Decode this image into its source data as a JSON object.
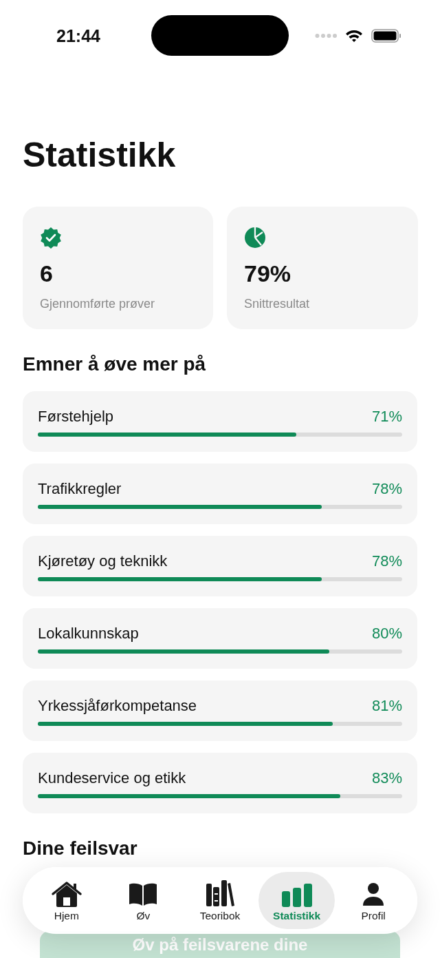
{
  "status_bar": {
    "time": "21:44"
  },
  "title": "Statistikk",
  "summary_cards": [
    {
      "kind": "badge",
      "value": "6",
      "label": "Gjennomførte prøver"
    },
    {
      "kind": "pie",
      "value": "79%",
      "label": "Snittresultat"
    }
  ],
  "topics_heading": "Emner å øve mer på",
  "topics": [
    {
      "name": "Førstehjelp",
      "percent": "71%",
      "level": 0.71
    },
    {
      "name": "Trafikkregler",
      "percent": "78%",
      "level": 0.78
    },
    {
      "name": "Kjøretøy og teknikk",
      "percent": "78%",
      "level": 0.78
    },
    {
      "name": "Lokalkunnskap",
      "percent": "80%",
      "level": 0.8
    },
    {
      "name": "Yrkessjåførkompetanse",
      "percent": "81%",
      "level": 0.81
    },
    {
      "name": "Kundeservice og etikk",
      "percent": "83%",
      "level": 0.83
    }
  ],
  "mistakes_heading": "Dine feilsvar",
  "practice_button": "Øv på feilsvarene dine",
  "tab_bar": [
    {
      "kind": "home",
      "label": "Hjem",
      "selected": false
    },
    {
      "kind": "book",
      "label": "Øv",
      "selected": false
    },
    {
      "kind": "books",
      "label": "Teoribok",
      "selected": false
    },
    {
      "kind": "chart",
      "label": "Statistikk",
      "selected": true
    },
    {
      "kind": "person",
      "label": "Profil",
      "selected": false
    }
  ]
}
